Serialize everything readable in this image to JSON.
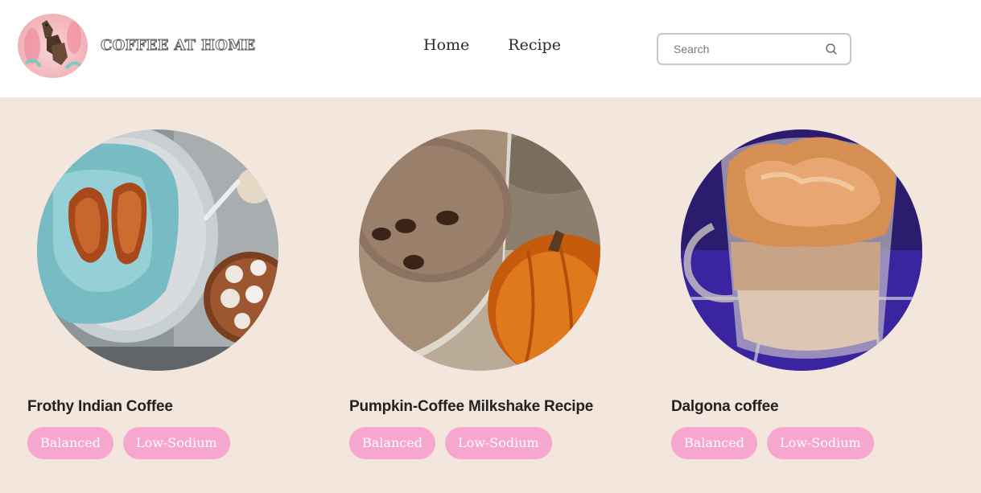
{
  "brand": {
    "name": "COFFEE AT HOME"
  },
  "nav": {
    "items": [
      {
        "label": "Home"
      },
      {
        "label": "Recipe"
      }
    ]
  },
  "search": {
    "placeholder": "Search",
    "value": ""
  },
  "colors": {
    "background": "#f3e6dc",
    "tag": "#f7a6cf",
    "header": "#ffffff"
  },
  "recipes": [
    {
      "title": "Frothy Indian Coffee",
      "tags": [
        "Balanced",
        "Low-Sodium"
      ],
      "image": "croissants-and-cookies-photo"
    },
    {
      "title": "Pumpkin-Coffee Milkshake Recipe",
      "tags": [
        "Balanced",
        "Low-Sodium"
      ],
      "image": "pumpkin-milkshake-photo"
    },
    {
      "title": "Dalgona coffee",
      "tags": [
        "Balanced",
        "Low-Sodium"
      ],
      "image": "dalgona-coffee-photo"
    }
  ]
}
